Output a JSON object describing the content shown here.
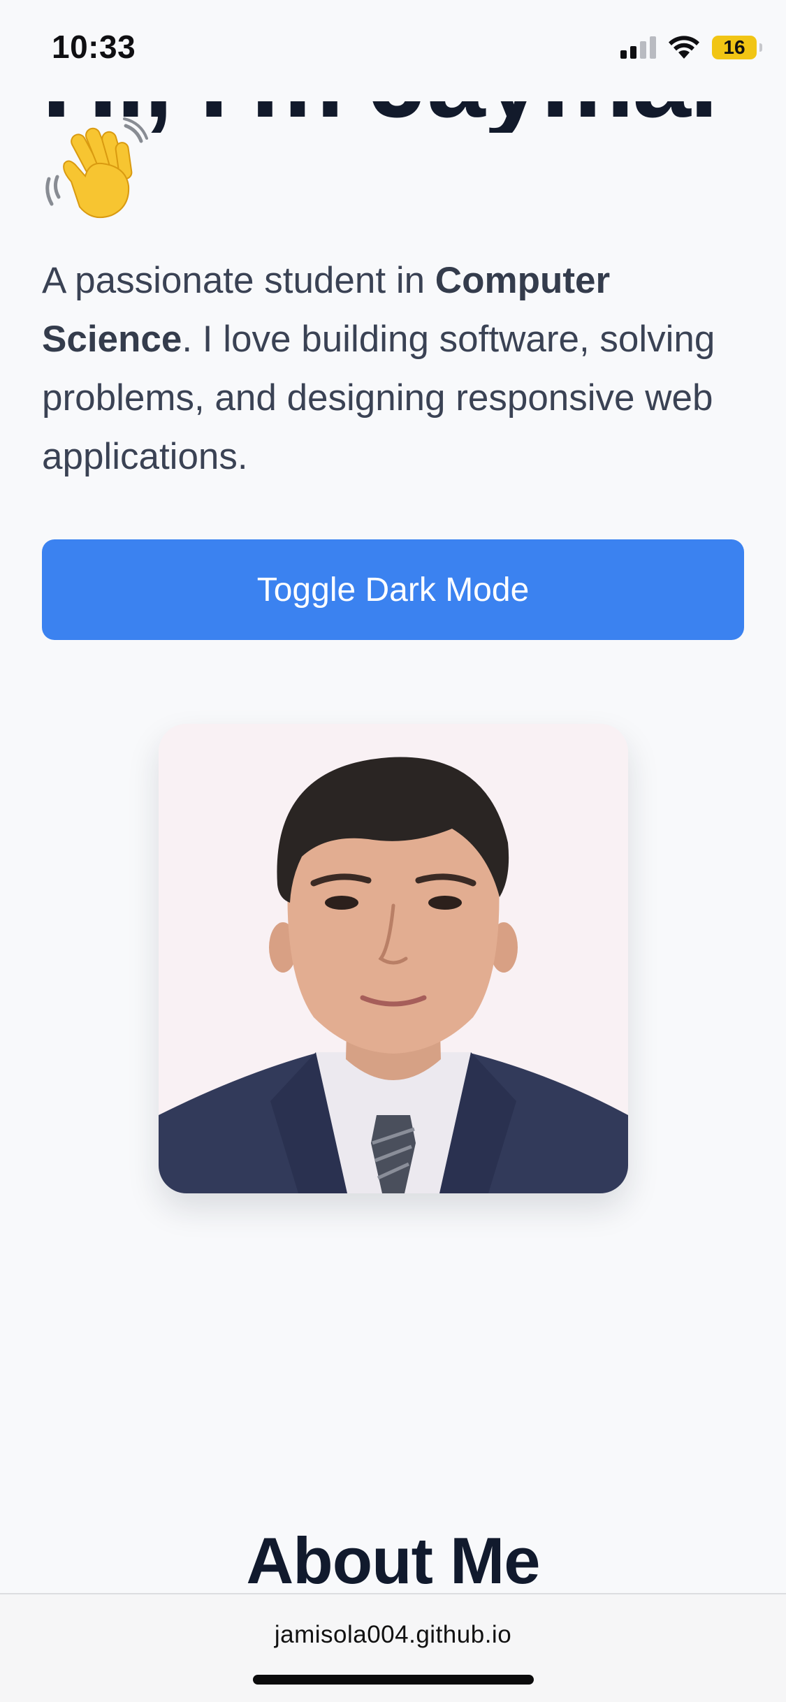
{
  "status_bar": {
    "time": "10:33",
    "battery_level": "16",
    "battery_color": "#f1c514",
    "icons": [
      "cellular-signal-icon",
      "wifi-icon",
      "battery-icon"
    ]
  },
  "hero": {
    "title": "Hi, I'm Jaymar",
    "wave_icon": "waving-hand-icon",
    "intro_prefix": "A passionate student in ",
    "intro_bold": "Computer Science",
    "intro_suffix": ". I love building software, solving problems, and designing responsive web applications."
  },
  "toggle_button": {
    "label": "Toggle Dark Mode",
    "color": "#3b82f0"
  },
  "profile_photo": {
    "subject": "portrait-photo"
  },
  "about": {
    "title": "About Me"
  },
  "browser": {
    "url": "jamisola004.github.io"
  }
}
